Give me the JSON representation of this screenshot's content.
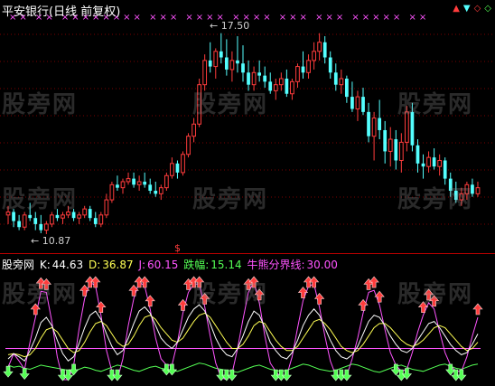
{
  "title": "平安银行(日线 前复权)",
  "colors": {
    "up": "#ff3c3c",
    "down": "#54ffff",
    "k": "#ffffff",
    "d": "#ffff54",
    "j": "#ff54ff",
    "drop": "#54ff54",
    "divider": "#b40000",
    "magenta_mark": "#ff54ff"
  },
  "main_chart": {
    "max_label": "17.50",
    "min_label": "10.87",
    "top_marks": "×× ×× ×××××××× ××× ×××× ×××× ××× ××× ××××× ××"
  },
  "corner_icons": [
    "up-arrow-icon",
    "down-arrow-icon",
    "diamond-icon",
    "diamond-icon"
  ],
  "indicator": {
    "name": "股旁网",
    "k_label": "K:",
    "k_value": "44.63",
    "d_label": "D:",
    "d_value": "36.87",
    "j_label": "J:",
    "j_value": "60.15",
    "drop_label": "跌幅:",
    "drop_value": "15.14",
    "line_label": "牛熊分界线:",
    "line_value": "30.00"
  },
  "watermark": "股旁网",
  "dollar_mark": "$",
  "chart_data": {
    "type": "candlestick",
    "price_range": [
      10.87,
      17.5
    ],
    "candles": [
      [
        11.5,
        11.8,
        11.2,
        11.6
      ],
      [
        11.6,
        11.7,
        11.1,
        11.3
      ],
      [
        11.3,
        11.5,
        11.0,
        11.1
      ],
      [
        11.1,
        11.6,
        11.0,
        11.5
      ],
      [
        11.5,
        11.9,
        11.3,
        11.4
      ],
      [
        11.4,
        11.6,
        11.0,
        11.2
      ],
      [
        11.2,
        11.5,
        10.9,
        11.0
      ],
      [
        11.0,
        11.3,
        10.87,
        11.2
      ],
      [
        11.2,
        11.6,
        11.1,
        11.5
      ],
      [
        11.5,
        11.7,
        11.3,
        11.4
      ],
      [
        11.4,
        11.6,
        11.2,
        11.5
      ],
      [
        11.5,
        11.8,
        11.4,
        11.6
      ],
      [
        11.6,
        11.7,
        11.3,
        11.4
      ],
      [
        11.4,
        11.6,
        11.2,
        11.5
      ],
      [
        11.5,
        11.8,
        11.4,
        11.7
      ],
      [
        11.7,
        11.8,
        11.3,
        11.4
      ],
      [
        11.4,
        11.6,
        11.1,
        11.2
      ],
      [
        11.2,
        11.6,
        11.1,
        11.5
      ],
      [
        11.5,
        12.2,
        11.4,
        12.0
      ],
      [
        12.0,
        12.6,
        11.9,
        12.5
      ],
      [
        12.5,
        12.8,
        12.3,
        12.4
      ],
      [
        12.4,
        12.7,
        12.2,
        12.6
      ],
      [
        12.6,
        12.9,
        12.5,
        12.7
      ],
      [
        12.7,
        12.9,
        12.4,
        12.5
      ],
      [
        12.5,
        12.8,
        12.3,
        12.6
      ],
      [
        12.6,
        12.9,
        12.4,
        12.5
      ],
      [
        12.5,
        12.7,
        12.2,
        12.3
      ],
      [
        12.3,
        12.6,
        12.1,
        12.2
      ],
      [
        12.2,
        12.5,
        12.0,
        12.4
      ],
      [
        12.4,
        12.9,
        12.3,
        12.8
      ],
      [
        12.8,
        13.4,
        12.7,
        13.2
      ],
      [
        13.2,
        13.3,
        12.7,
        12.9
      ],
      [
        12.9,
        13.6,
        12.8,
        13.5
      ],
      [
        13.5,
        14.2,
        13.4,
        14.1
      ],
      [
        14.1,
        14.7,
        13.9,
        14.5
      ],
      [
        14.5,
        16.0,
        14.4,
        15.8
      ],
      [
        15.8,
        16.8,
        15.6,
        16.6
      ],
      [
        16.6,
        17.2,
        16.2,
        16.4
      ],
      [
        16.4,
        17.0,
        16.0,
        16.9
      ],
      [
        16.9,
        17.5,
        16.5,
        16.7
      ],
      [
        16.7,
        17.3,
        16.1,
        16.3
      ],
      [
        16.3,
        16.9,
        15.9,
        16.6
      ],
      [
        16.6,
        17.4,
        16.2,
        16.5
      ],
      [
        16.5,
        17.1,
        15.9,
        16.2
      ],
      [
        16.2,
        16.6,
        15.6,
        15.8
      ],
      [
        15.8,
        16.4,
        15.6,
        16.2
      ],
      [
        16.2,
        16.6,
        15.9,
        16.1
      ],
      [
        16.1,
        16.4,
        15.7,
        15.9
      ],
      [
        15.9,
        16.2,
        15.5,
        15.6
      ],
      [
        15.6,
        16.0,
        15.3,
        15.8
      ],
      [
        15.8,
        16.2,
        15.6,
        16.0
      ],
      [
        16.0,
        16.3,
        15.4,
        15.5
      ],
      [
        15.5,
        16.0,
        15.3,
        15.9
      ],
      [
        15.9,
        16.5,
        15.7,
        16.4
      ],
      [
        16.4,
        16.9,
        16.0,
        16.2
      ],
      [
        16.2,
        16.8,
        16.0,
        16.6
      ],
      [
        16.6,
        17.2,
        16.3,
        16.9
      ],
      [
        16.9,
        17.5,
        16.6,
        17.2
      ],
      [
        17.2,
        17.4,
        16.5,
        16.7
      ],
      [
        16.7,
        16.9,
        16.0,
        16.2
      ],
      [
        16.2,
        16.5,
        15.6,
        15.8
      ],
      [
        15.8,
        16.3,
        15.5,
        16.0
      ],
      [
        16.0,
        16.1,
        15.2,
        15.4
      ],
      [
        15.4,
        15.9,
        14.9,
        15.0
      ],
      [
        15.0,
        15.6,
        14.6,
        15.4
      ],
      [
        15.4,
        15.7,
        14.8,
        14.9
      ],
      [
        14.9,
        15.2,
        13.9,
        14.1
      ],
      [
        14.1,
        14.9,
        13.3,
        14.7
      ],
      [
        14.7,
        15.3,
        14.0,
        14.3
      ],
      [
        14.3,
        14.6,
        13.2,
        13.6
      ],
      [
        13.6,
        14.4,
        13.1,
        14.0
      ],
      [
        14.0,
        14.3,
        13.0,
        13.3
      ],
      [
        13.3,
        14.2,
        12.9,
        13.9
      ],
      [
        13.9,
        15.1,
        13.6,
        14.9
      ],
      [
        14.9,
        15.2,
        13.6,
        13.8
      ],
      [
        13.8,
        14.0,
        12.9,
        13.2
      ],
      [
        13.2,
        13.5,
        12.7,
        13.1
      ],
      [
        13.1,
        13.6,
        12.9,
        13.4
      ],
      [
        13.4,
        13.7,
        13.0,
        13.1
      ],
      [
        13.1,
        13.5,
        12.8,
        13.3
      ],
      [
        13.3,
        13.4,
        12.5,
        12.7
      ],
      [
        12.7,
        12.9,
        12.1,
        12.3
      ],
      [
        12.3,
        12.6,
        11.9,
        12.0
      ],
      [
        12.0,
        12.4,
        11.8,
        12.2
      ],
      [
        12.2,
        12.6,
        12.0,
        12.5
      ],
      [
        12.5,
        12.7,
        12.1,
        12.2
      ],
      [
        12.2,
        12.6,
        12.1,
        12.4
      ]
    ],
    "indicator_series": {
      "K": [
        20,
        25,
        22,
        18,
        28,
        40,
        55,
        60,
        52,
        38,
        25,
        18,
        22,
        35,
        50,
        62,
        66,
        58,
        44,
        32,
        24,
        28,
        40,
        54,
        66,
        70,
        64,
        52,
        40,
        34,
        30,
        36,
        48,
        60,
        68,
        72,
        66,
        54,
        40,
        30,
        24,
        22,
        30,
        42,
        56,
        66,
        62,
        50,
        36,
        28,
        22,
        20,
        26,
        38,
        52,
        62,
        68,
        62,
        50,
        38,
        28,
        22,
        20,
        24,
        32,
        44,
        56,
        62,
        60,
        52,
        42,
        34,
        28,
        26,
        30,
        38,
        46,
        54,
        56,
        50,
        42,
        34,
        28,
        24,
        26,
        34,
        44
      ],
      "D": [
        24,
        25,
        24,
        22,
        24,
        30,
        40,
        48,
        50,
        46,
        38,
        30,
        26,
        28,
        36,
        46,
        54,
        56,
        52,
        44,
        36,
        32,
        34,
        42,
        52,
        60,
        62,
        58,
        50,
        44,
        38,
        36,
        40,
        48,
        56,
        62,
        64,
        60,
        52,
        44,
        36,
        30,
        30,
        34,
        42,
        52,
        56,
        54,
        46,
        38,
        32,
        28,
        28,
        32,
        40,
        48,
        56,
        58,
        54,
        48,
        40,
        32,
        28,
        26,
        28,
        34,
        42,
        50,
        54,
        54,
        50,
        44,
        38,
        34,
        32,
        34,
        38,
        44,
        50,
        52,
        50,
        44,
        38,
        32,
        28,
        30,
        36
      ],
      "J": [
        12,
        25,
        18,
        10,
        36,
        60,
        85,
        84,
        56,
        22,
        0,
        0,
        14,
        49,
        78,
        94,
        90,
        62,
        28,
        8,
        0,
        20,
        52,
        78,
        94,
        90,
        68,
        40,
        20,
        14,
        14,
        36,
        64,
        84,
        92,
        92,
        70,
        42,
        16,
        2,
        0,
        6,
        30,
        58,
        84,
        94,
        74,
        42,
        16,
        8,
        2,
        4,
        22,
        50,
        76,
        90,
        92,
        70,
        42,
        18,
        4,
        2,
        4,
        20,
        40,
        64,
        84,
        86,
        72,
        48,
        26,
        14,
        8,
        10,
        26,
        46,
        62,
        74,
        68,
        46,
        26,
        14,
        8,
        8,
        22,
        42,
        60
      ],
      "drop": [
        14,
        12,
        13,
        11,
        10,
        12,
        14,
        13,
        12,
        11,
        10,
        9,
        8,
        10,
        12,
        11,
        9,
        8,
        10,
        12,
        14,
        13,
        11,
        9,
        8,
        10,
        12,
        13,
        11,
        10,
        9,
        8,
        10,
        12,
        14,
        16,
        15,
        13,
        11,
        10,
        9,
        8,
        7,
        9,
        11,
        13,
        14,
        12,
        10,
        9,
        8,
        9,
        11,
        13,
        15,
        14,
        12,
        10,
        9,
        8,
        9,
        11,
        13,
        15,
        14,
        12,
        10,
        8,
        7,
        9,
        11,
        13,
        14,
        12,
        10,
        9,
        8,
        10,
        12,
        14,
        15,
        13,
        11,
        10,
        12,
        14,
        15
      ],
      "bull_bear_line": 30
    }
  }
}
